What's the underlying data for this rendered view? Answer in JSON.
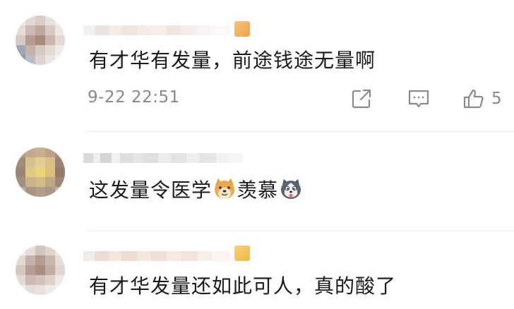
{
  "comments": [
    {
      "text": "有才华有发量，前途钱途无量啊",
      "timestamp": "9-22 22:51",
      "like_count": "5"
    },
    {
      "text_part1": "这发量令医学",
      "emoji_1": "doge-dog-emoji",
      "text_part2": "羡慕",
      "emoji_2": "husky-face-emoji"
    },
    {
      "text": "有才华发量还如此可人，真的酸了"
    }
  ],
  "icons": {
    "share": "share-icon",
    "comment": "comment-icon",
    "like": "thumbs-up-icon"
  },
  "colors": {
    "text": "#1a1a1a",
    "meta": "#888888",
    "divider": "#ececec"
  }
}
